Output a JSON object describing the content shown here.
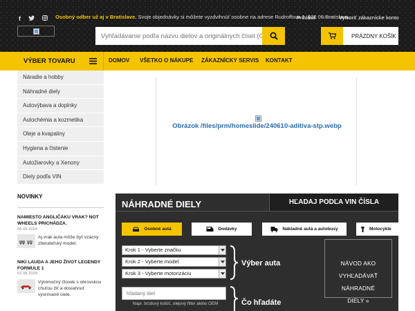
{
  "header": {
    "announcement_bold": "Osobný odber už aj v Bratislave.",
    "announcement_rest": "Svoje objednávky si môžete vyzdvihnúť osobne na adrese Rudroffova 1, 831 06 Bratislava.",
    "login": "Prihlásiť",
    "or": "alebo",
    "register": "Vytvoriť zákaznícke konto",
    "search_placeholder": "Vyhľadávanie podľa názvu dielov a originálnych čísel (OEM",
    "cart_label": "PRÁZDNY KOŠÍK",
    "social_icons": [
      "facebook-icon",
      "twitter-icon",
      "instagram-icon"
    ]
  },
  "nav": {
    "products": "VÝBER TOVARU",
    "links": [
      "DOMOV",
      "VŠETKO O NÁKUPE",
      "ZÁKAZNÍCKY SERVIS",
      "KONTAKT"
    ]
  },
  "sidebar": {
    "items": [
      {
        "label": "Náradie a hobby"
      },
      {
        "label": "Náhradné diely"
      },
      {
        "label": "Autovýbava a doplnky"
      },
      {
        "label": "Autochémia a kozmetika"
      },
      {
        "label": "Oleje a kvapaliny"
      },
      {
        "label": "Hygiena a čistenie"
      },
      {
        "label": "Autožiarovky a Xenony"
      },
      {
        "label": "Diely podľa VIN"
      }
    ]
  },
  "news": {
    "heading": "NOVINKY",
    "items": [
      {
        "title": "NAMIESTO ANGLIČÁKU VRAK? NOT WHEELS PRICHÁDZA.",
        "date": "06.09.2024",
        "text": "Aj vrak auta môže byť vzácny zberateľský model."
      },
      {
        "title": "NIKI LAUDA A JEHO ŽIVOT LEGENDY FORMULE 1",
        "date": "02.08.2024",
        "text": "Výnimočný človek s obrovskou chuťou žiť a dosiahnuť vysnívané ciele."
      }
    ]
  },
  "banner": {
    "alt_text": "Obrázok /files/prm/homeslide/240610-aditiva-stp.webp"
  },
  "finder": {
    "title": "NÁHRADNÉ DIELY",
    "vin_tab": "HĽADAJ PODĽA VIN ČÍSLA",
    "vehicle_types": [
      "Osobné autá",
      "Dodávky",
      "Nákladné autá a autobusy",
      "Motocykle"
    ],
    "selected_vehicle_type": "Osobné autá",
    "selects": {
      "make": "Krok 1 - Vyberte značku",
      "model": "Krok 2 - Vyberte model",
      "engine": "Krok 3 - Vyberte motorizáciu"
    },
    "choose_car": "Výber auta",
    "part_placeholder": "hľadaný diel",
    "part_hint": "Napr. brzdový kotúč, olejový filter alebo OEM",
    "what_search": "Čo hľadáte",
    "howto_lines": [
      "NÁVOD AKO",
      "VYHĽADÁVAŤ",
      "NÁHRADNÉ",
      "DIELY »"
    ]
  },
  "colors": {
    "accent": "#f5c400",
    "header_bg": "#1b1b1b",
    "finder_bg": "#2e2e2e",
    "link": "#2a6cb0"
  }
}
